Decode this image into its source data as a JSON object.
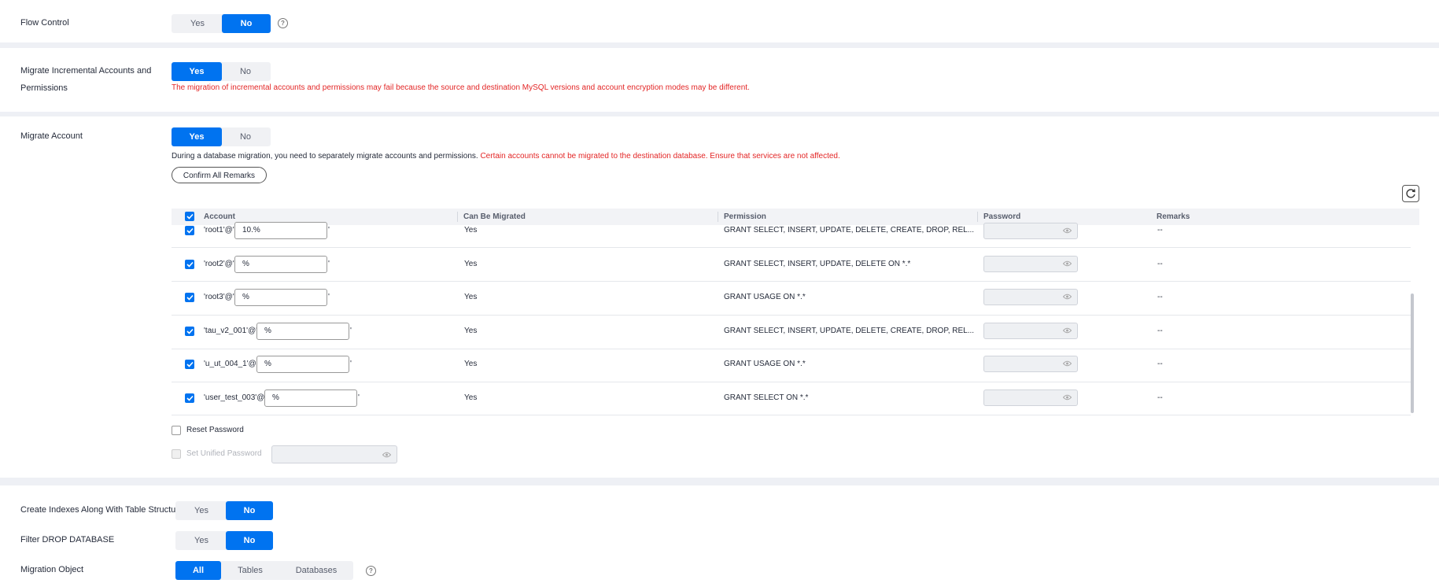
{
  "flow_control": {
    "label": "Flow Control",
    "yes": "Yes",
    "no": "No",
    "selected": "No",
    "help": "?"
  },
  "incremental": {
    "label_line1": "Migrate Incremental Accounts and",
    "label_line2": "Permissions",
    "yes": "Yes",
    "no": "No",
    "selected": "Yes",
    "warning": "The migration of incremental accounts and permissions may fail because the source and destination MySQL versions and account encryption modes may be different."
  },
  "migrate_account": {
    "label": "Migrate Account",
    "yes": "Yes",
    "no": "No",
    "selected": "Yes",
    "note": "During a database migration, you need to separately migrate accounts and permissions.",
    "note_red": "Certain accounts cannot be migrated to the destination database. Ensure that services are not affected.",
    "confirm_button": "Confirm All Remarks"
  },
  "table": {
    "headers": {
      "account": "Account",
      "migrated": "Can Be Migrated",
      "permission": "Permission",
      "password": "Password",
      "remarks": "Remarks"
    },
    "rows": [
      {
        "prefix": "'root1'@'",
        "host": "10.%",
        "suffix": "'",
        "migrated": "Yes",
        "permission": "GRANT SELECT, INSERT, UPDATE, DELETE, CREATE, DROP, REL...",
        "remarks": "--"
      },
      {
        "prefix": "'root2'@'",
        "host": "%",
        "suffix": "'",
        "migrated": "Yes",
        "permission": "GRANT SELECT, INSERT, UPDATE, DELETE ON *.*",
        "remarks": "--"
      },
      {
        "prefix": "'root3'@'",
        "host": "%",
        "suffix": "'",
        "migrated": "Yes",
        "permission": "GRANT USAGE ON *.*",
        "remarks": "--"
      },
      {
        "prefix": "'tau_v2_001'@'",
        "host": "%",
        "suffix": "'",
        "migrated": "Yes",
        "permission": "GRANT SELECT, INSERT, UPDATE, DELETE, CREATE, DROP, REL...",
        "remarks": "--"
      },
      {
        "prefix": "'u_ut_004_1'@'",
        "host": "%",
        "suffix": "'",
        "migrated": "Yes",
        "permission": "GRANT USAGE ON *.*",
        "remarks": "--"
      },
      {
        "prefix": "'user_test_003'@'",
        "host": "%",
        "suffix": "'",
        "migrated": "Yes",
        "permission": "GRANT SELECT ON *.*",
        "remarks": "--"
      }
    ]
  },
  "reset_password": {
    "label": "Reset Password"
  },
  "unified_password": {
    "label": "Set Unified Password"
  },
  "create_indexes": {
    "label": "Create Indexes Along With Table Structure",
    "yes": "Yes",
    "no": "No",
    "selected": "No"
  },
  "filter_drop": {
    "label": "Filter DROP DATABASE",
    "yes": "Yes",
    "no": "No",
    "selected": "No"
  },
  "migration_object": {
    "label": "Migration Object",
    "all": "All",
    "tables": "Tables",
    "databases": "Databases",
    "selected": "All",
    "help": "?"
  },
  "colors": {
    "accent": "#0073f0",
    "warning": "#e32626",
    "background": "#eef0f5"
  }
}
